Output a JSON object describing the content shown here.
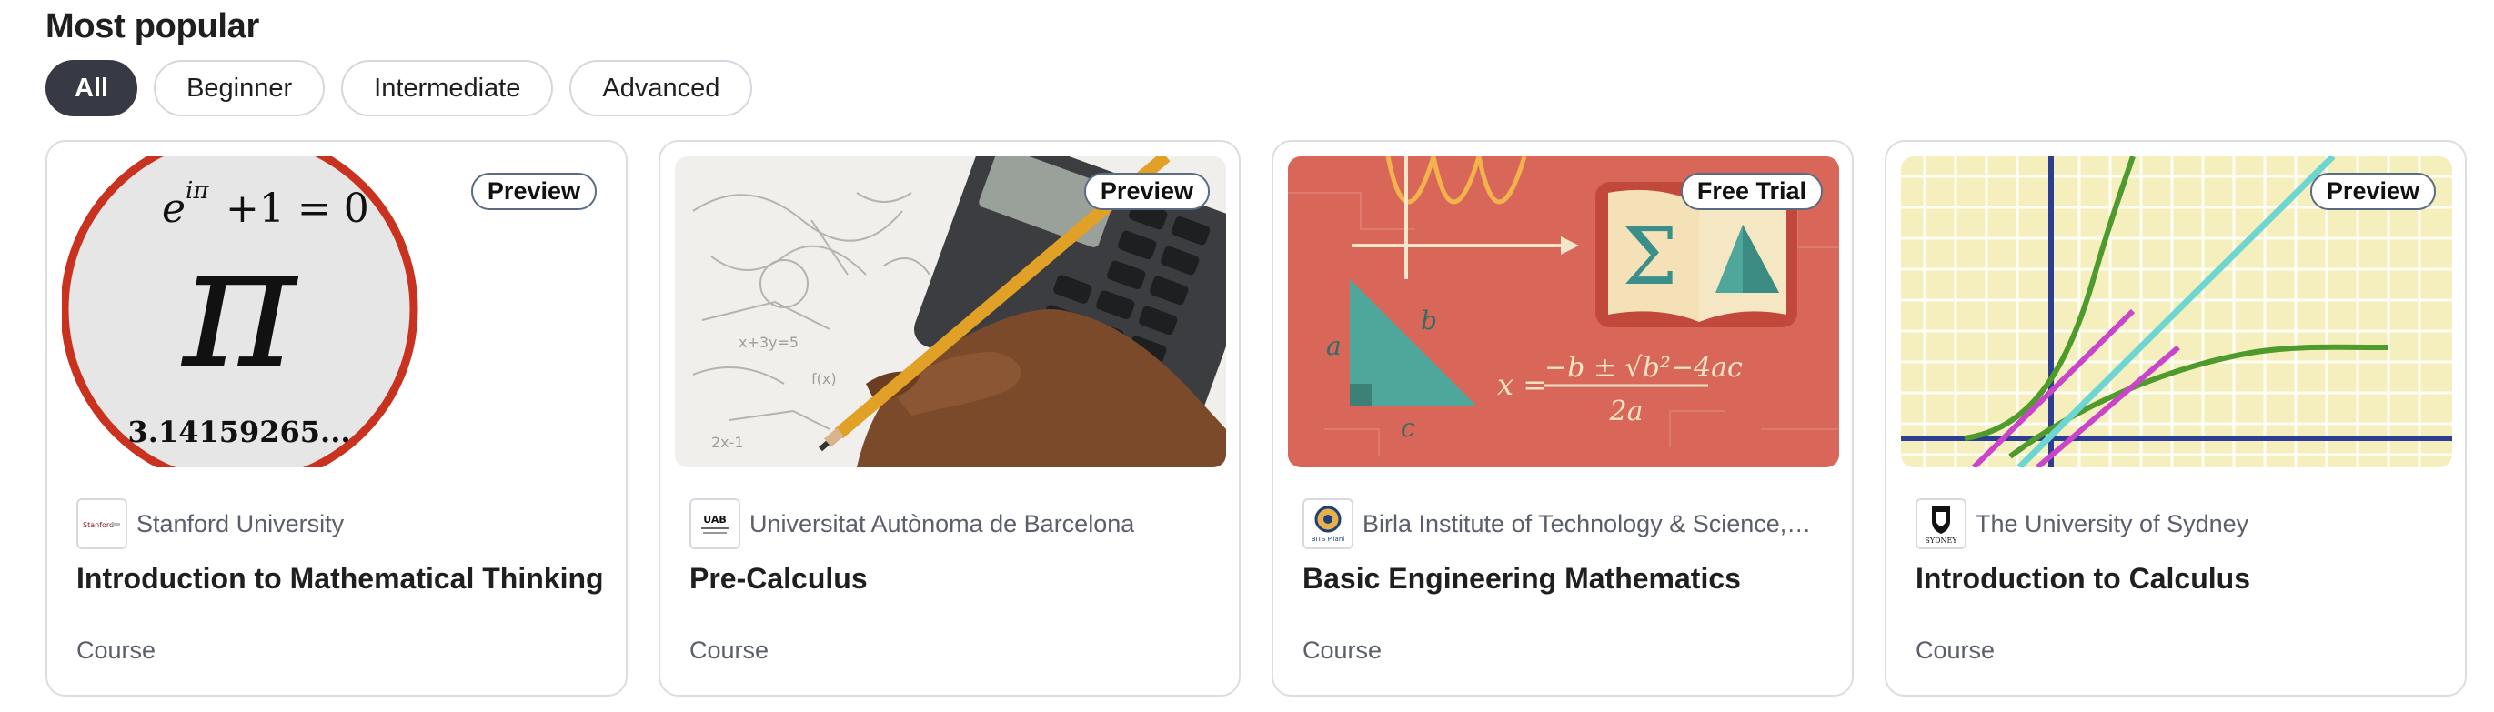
{
  "section": {
    "title": "Most popular"
  },
  "filters": [
    {
      "label": "All",
      "active": true
    },
    {
      "label": "Beginner",
      "active": false
    },
    {
      "label": "Intermediate",
      "active": false
    },
    {
      "label": "Advanced",
      "active": false
    }
  ],
  "cards": [
    {
      "badge": "Preview",
      "partner": "Stanford University",
      "partner_logo_text": "Stanford",
      "title": "Introduction to Mathematical Thinking",
      "type": "Course",
      "image_text": {
        "equation": "+1 = 0",
        "base": "e",
        "exponent": "iπ",
        "symbol": "π",
        "digits": "3.14159265..."
      }
    },
    {
      "badge": "Preview",
      "partner": "Universitat Autònoma de Barcelona",
      "partner_logo_text": "UAB",
      "title": "Pre-Calculus",
      "type": "Course"
    },
    {
      "badge": "Free Trial",
      "partner": "Birla Institute of Technology & Science,…",
      "partner_logo_text": "BITS Pilani",
      "title": "Basic Engineering Mathematics",
      "type": "Course",
      "image_text": {
        "sigma": "Σ",
        "side_a": "a",
        "side_b": "b",
        "side_c": "c",
        "formula_x": "x =",
        "formula_num": "−b ± √b²−4ac",
        "formula_den": "2a"
      }
    },
    {
      "badge": "Preview",
      "partner": "The University of Sydney",
      "partner_logo_text": "SYDNEY",
      "title": "Introduction to Calculus",
      "type": "Course"
    }
  ],
  "colors": {
    "chip_active_bg": "#373a45",
    "card_border": "#dadde2",
    "muted_text": "#5b5f6a"
  }
}
